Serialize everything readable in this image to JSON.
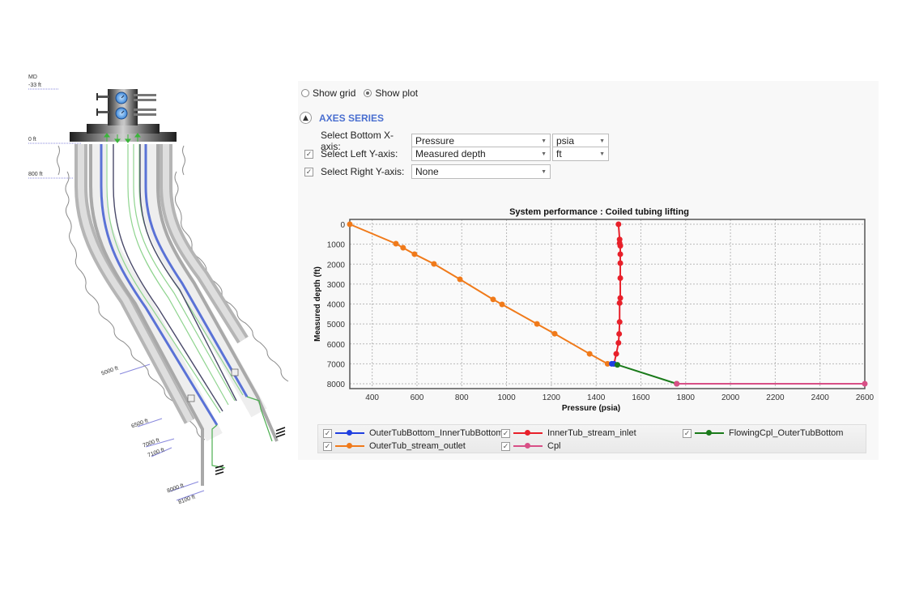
{
  "wellbore": {
    "md_header": "MD",
    "depth_markers": [
      {
        "label": "-33 ft"
      },
      {
        "label": "0 ft"
      },
      {
        "label": "800 ft"
      },
      {
        "label": "5000 ft"
      },
      {
        "label": "6500 ft"
      },
      {
        "label": "7000 ft"
      },
      {
        "label": "7100 ft"
      },
      {
        "label": "8000 ft"
      },
      {
        "label": "8100 ft"
      }
    ]
  },
  "panel": {
    "radio_show_grid": "Show grid",
    "radio_show_plot": "Show plot",
    "selected_view": "Show plot",
    "section_title": "AXES SERIES",
    "collapse_icon": "chevron-up-icon",
    "axes": [
      {
        "label": "Select Bottom X-axis:",
        "checkbox": false,
        "has_checkbox": false,
        "value": "Pressure",
        "unit": "psia"
      },
      {
        "label": "Select Left Y-axis:",
        "checkbox": true,
        "has_checkbox": true,
        "value": "Measured depth",
        "unit": "ft"
      },
      {
        "label": "Select Right Y-axis:",
        "checkbox": true,
        "has_checkbox": true,
        "value": "None",
        "unit": null
      }
    ],
    "check_glyph": "✓",
    "dropdown_glyph": "▼"
  },
  "legend": [
    {
      "name": "OuterTubBottom_InnerTubBottom",
      "color": "#1f3fe0",
      "checked": true
    },
    {
      "name": "InnerTub_stream_inlet",
      "color": "#e8202a",
      "checked": true
    },
    {
      "name": "FlowingCpl_OuterTubBottom",
      "color": "#1a7a1a",
      "checked": true
    },
    {
      "name": "OuterTub_stream_outlet",
      "color": "#f07a1a",
      "checked": true
    },
    {
      "name": "Cpl",
      "color": "#d84f86",
      "checked": true
    }
  ],
  "chart_data": {
    "type": "line",
    "title": "System performance : Coiled tubing lifting",
    "xlabel": "Pressure (psia)",
    "ylabel": "Measured depth (ft)",
    "xlim": [
      300,
      2600
    ],
    "ylim": [
      0,
      8000
    ],
    "y_inverted": true,
    "grid": true,
    "legend_position": "bottom",
    "xticks": [
      400,
      600,
      800,
      1000,
      1200,
      1400,
      1600,
      1800,
      2000,
      2200,
      2400,
      2600
    ],
    "yticks": [
      0,
      1000,
      2000,
      3000,
      4000,
      5000,
      6000,
      7000,
      8000
    ],
    "series": [
      {
        "name": "OuterTub_stream_outlet",
        "color": "#f07a1a",
        "x": [
          300,
          506,
          538,
          589,
          676,
          792,
          940,
          980,
          1136,
          1215,
          1371,
          1451
        ],
        "y": [
          0,
          975,
          1180,
          1500,
          1990,
          2760,
          3770,
          4020,
          5000,
          5490,
          6500,
          7000
        ]
      },
      {
        "name": "InnerTub_stream_inlet",
        "color": "#e8202a",
        "x": [
          1500,
          1505,
          1505,
          1508,
          1508,
          1508,
          1508,
          1508,
          1505,
          1505,
          1503,
          1500,
          1490,
          1480
        ],
        "y": [
          0,
          760,
          950,
          1080,
          1500,
          1950,
          2700,
          3700,
          3950,
          4900,
          5500,
          5950,
          6500,
          7000
        ]
      },
      {
        "name": "OuterTubBottom_InnerTubBottom",
        "color": "#1f3fe0",
        "x": [
          1470,
          1480
        ],
        "y": [
          7000,
          7000
        ]
      },
      {
        "name": "FlowingCpl_OuterTubBottom",
        "color": "#1a7a1a",
        "x": [
          1495,
          1760
        ],
        "y": [
          7050,
          8000
        ]
      },
      {
        "name": "Cpl",
        "color": "#d84f86",
        "x": [
          1760,
          2600
        ],
        "y": [
          8000,
          8000
        ]
      }
    ]
  }
}
